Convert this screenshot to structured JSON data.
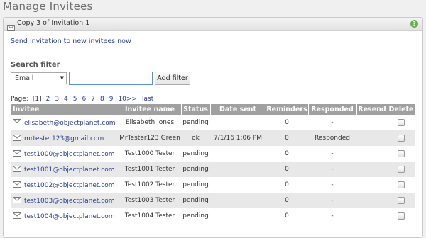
{
  "page": {
    "title": "Manage Invitees"
  },
  "panel": {
    "title": "Copy 3 of Invitation 1",
    "send_link": "Send invitation to new invitees now"
  },
  "filter": {
    "label": "Search filter",
    "field_selected": "Email",
    "input_value": "",
    "add_button": "Add filter"
  },
  "pager": {
    "label": "Page:",
    "current": "[1]",
    "pages": [
      "2",
      "3",
      "4",
      "5",
      "6",
      "7",
      "8",
      "9"
    ],
    "next": "10>>",
    "last": "last"
  },
  "table": {
    "headers": [
      "Invitee",
      "Invitee name",
      "Status",
      "Date sent",
      "Reminders",
      "Responded",
      "Resend",
      "Delete"
    ],
    "rows": [
      {
        "email": "elisabeth@objectplanet.com",
        "name": "Elisabeth Jones",
        "status": "pending",
        "date": "",
        "reminders": "0",
        "responded": "-"
      },
      {
        "email": "mrtester123@gmail.com",
        "name": "MrTester123 Green",
        "status": "ok",
        "date": "7/1/16 1:06 PM",
        "reminders": "0",
        "responded": "Responded"
      },
      {
        "email": "test1000@objectplanet.com",
        "name": "Test1000 Tester",
        "status": "pending",
        "date": "",
        "reminders": "0",
        "responded": "-"
      },
      {
        "email": "test1001@objectplanet.com",
        "name": "Test1001 Tester",
        "status": "pending",
        "date": "",
        "reminders": "0",
        "responded": "-"
      },
      {
        "email": "test1002@objectplanet.com",
        "name": "Test1002 Tester",
        "status": "pending",
        "date": "",
        "reminders": "0",
        "responded": "-"
      },
      {
        "email": "test1003@objectplanet.com",
        "name": "Test1003 Tester",
        "status": "pending",
        "date": "",
        "reminders": "0",
        "responded": "-"
      },
      {
        "email": "test1004@objectplanet.com",
        "name": "Test1004 Tester",
        "status": "pending",
        "date": "",
        "reminders": "0",
        "responded": "-"
      }
    ]
  },
  "icons": {
    "panel": "envelope-icon",
    "help": "help-icon",
    "row": "mail-icon"
  },
  "colors": {
    "header_bg": "#a0a0a0",
    "link": "#2a3f8f",
    "alt_row": "#e8e8e8",
    "help": "#6ab04c"
  }
}
